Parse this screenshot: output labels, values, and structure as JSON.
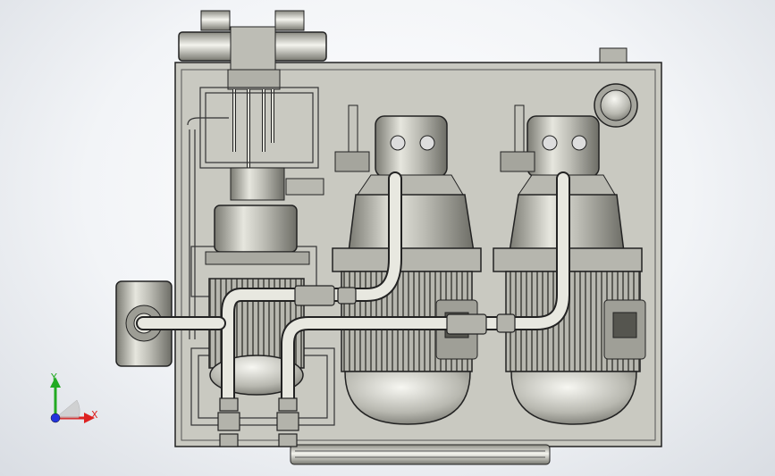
{
  "viewport": {
    "background_top": "#ffffff",
    "background_bottom": "#d9dde3"
  },
  "triad": {
    "y_label": "Y",
    "x_label": "X",
    "y_color": "#22aa22",
    "x_color": "#dd2222",
    "z_color": "#2233dd"
  },
  "model": {
    "body_color": "#c9c9c1",
    "shade_color": "#8e8e86",
    "edge_color": "#222222"
  }
}
